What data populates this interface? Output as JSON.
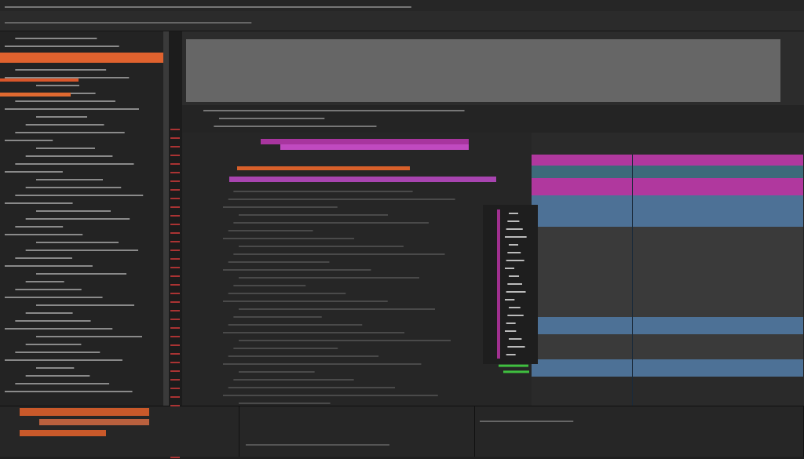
{
  "left_highlights": [
    {
      "color": "#e0622e"
    },
    {
      "color": "#d9562a"
    },
    {
      "color": "#e06a30"
    }
  ],
  "editor_clips": [
    {
      "color": "#a8359f"
    },
    {
      "color": "#c04ac0"
    },
    {
      "color": "#d8602a"
    },
    {
      "color": "#a844b0"
    }
  ],
  "tracks": [
    {
      "color": "#b0389e"
    },
    {
      "color": "#3d6a7a"
    },
    {
      "color": "#b0389e"
    },
    {
      "color": "#4d7196"
    },
    {
      "color": "#3a3a3a"
    },
    {
      "color": "#4d7196"
    },
    {
      "color": "#3a3a3a"
    },
    {
      "color": "#4d7196"
    }
  ],
  "bottom_bars": [
    {
      "color": "#c9592a"
    },
    {
      "color": "#b9603e"
    },
    {
      "color": "#c9592a"
    }
  ]
}
